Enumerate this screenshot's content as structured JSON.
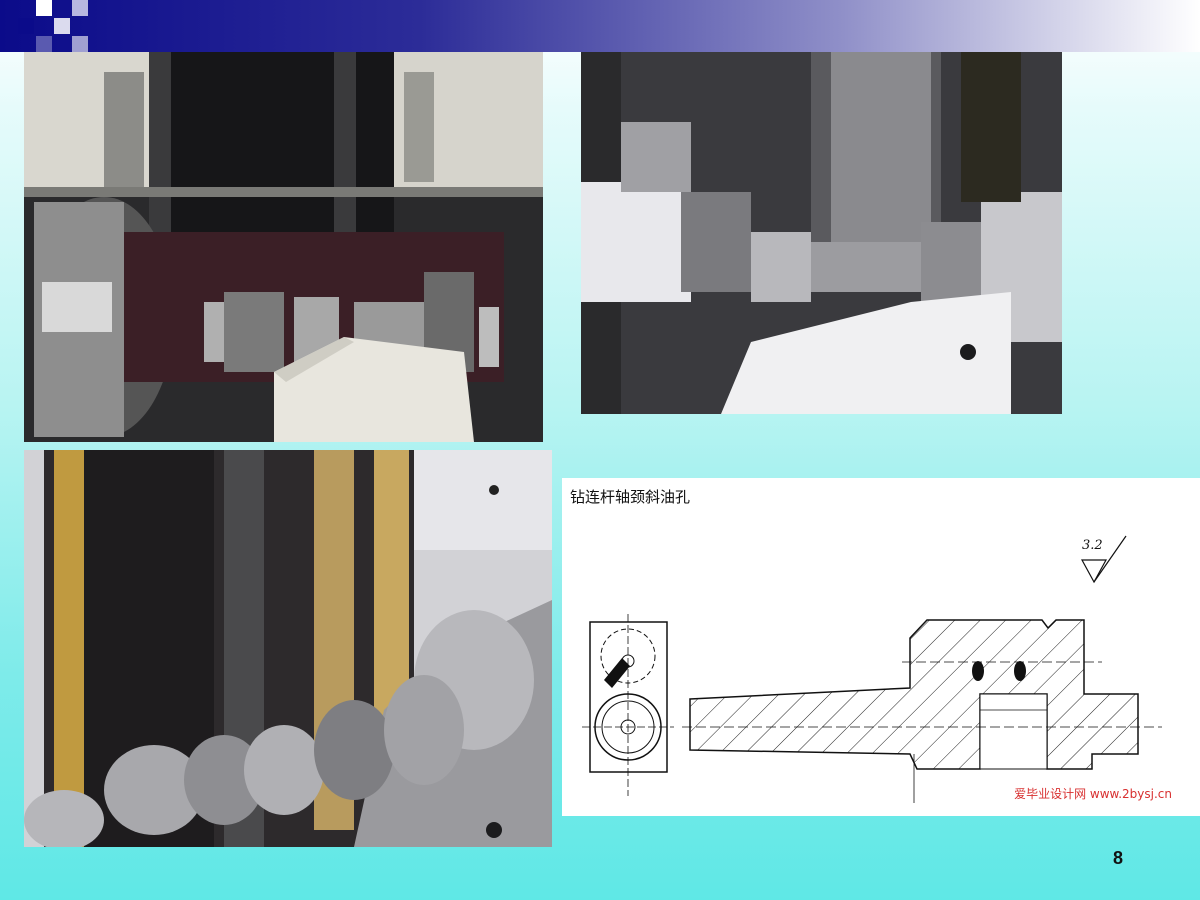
{
  "slide": {
    "page_number": "8",
    "accent_color": "#0b0b8a"
  },
  "photos": [
    {
      "name": "crankshaft-turning-photo-1",
      "icon": "machine-photo"
    },
    {
      "name": "crankshaft-turning-photo-2",
      "icon": "machine-photo"
    },
    {
      "name": "crankshaft-grinding-photo",
      "icon": "machine-photo"
    }
  ],
  "drawing": {
    "title": "钻连杆轴颈斜油孔",
    "roughness": "3.2",
    "watermark": "爱毕业设计网 www.2bysj.cn"
  }
}
